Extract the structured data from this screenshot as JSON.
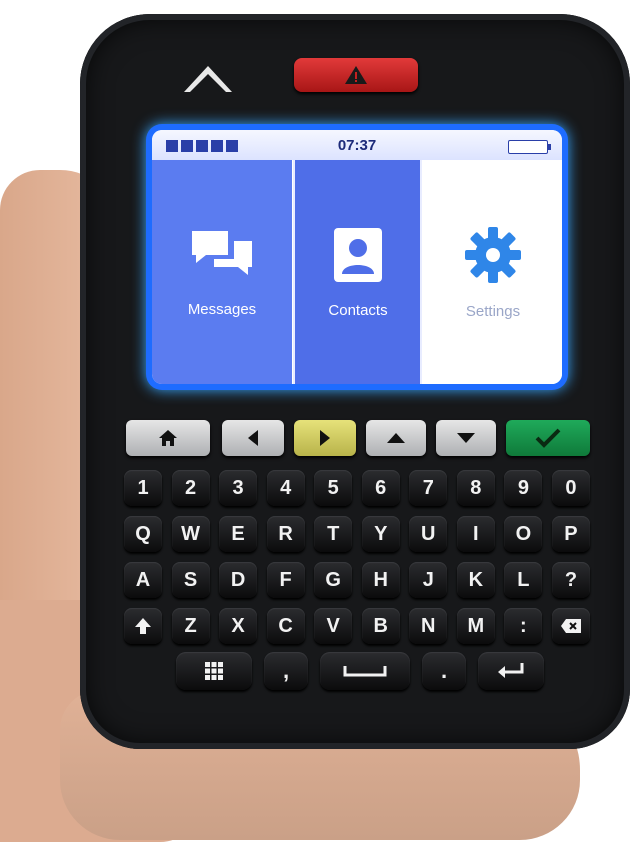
{
  "status_bar": {
    "time": "07:37",
    "signal_bars": 5,
    "battery_icon": "battery-icon"
  },
  "menu": {
    "tiles": [
      {
        "label": "Messages",
        "icon": "chat-bubbles-icon"
      },
      {
        "label": "Contacts",
        "icon": "contact-card-icon"
      },
      {
        "label": "Settings",
        "icon": "gear-icon"
      }
    ]
  },
  "hardware": {
    "alert_button_icon": "warning-triangle-icon",
    "logo_icon": "brand-chevron-icon",
    "nav_keys": [
      "home-icon",
      "arrow-left-icon",
      "arrow-right-icon",
      "arrow-up-icon",
      "arrow-down-icon",
      "checkmark-icon"
    ]
  },
  "keyboard": {
    "row1": [
      "1",
      "2",
      "3",
      "4",
      "5",
      "6",
      "7",
      "8",
      "9",
      "0"
    ],
    "row2": [
      "Q",
      "W",
      "E",
      "R",
      "T",
      "Y",
      "U",
      "I",
      "O",
      "P"
    ],
    "row3": [
      "A",
      "S",
      "D",
      "F",
      "G",
      "H",
      "J",
      "K",
      "L",
      "?"
    ],
    "row4": [
      "",
      "Z",
      "X",
      "C",
      "V",
      "B",
      "N",
      "M",
      ":",
      ""
    ],
    "bottom": {
      "comma": ",",
      "period": "."
    }
  },
  "colors": {
    "screen_glow": "#1e6cff",
    "alert_red": "#c42020",
    "confirm_green": "#1a9a4e",
    "nav_yellow": "#d4cf62"
  }
}
